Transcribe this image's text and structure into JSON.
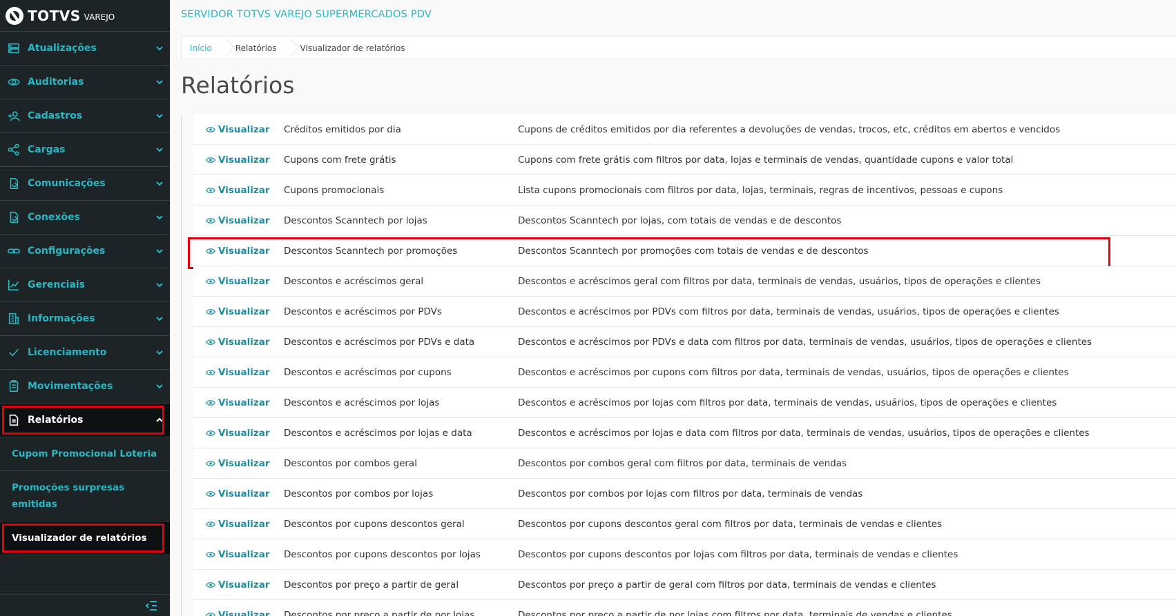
{
  "brand": {
    "name": "TOTVS",
    "sub": "VAREJO"
  },
  "sidebar": {
    "items": [
      {
        "label": "Atualizações",
        "icon": "server-icon"
      },
      {
        "label": "Auditorias",
        "icon": "eye-icon"
      },
      {
        "label": "Cadastros",
        "icon": "user-add-icon"
      },
      {
        "label": "Cargas",
        "icon": "share-icon"
      },
      {
        "label": "Comunicações",
        "icon": "document-sync-icon"
      },
      {
        "label": "Conexões",
        "icon": "document-sync-icon"
      },
      {
        "label": "Configurações",
        "icon": "link-icon"
      },
      {
        "label": "Gerenciais",
        "icon": "chart-icon"
      },
      {
        "label": "Informações",
        "icon": "building-icon"
      },
      {
        "label": "Licenciamento",
        "icon": "check-icon"
      },
      {
        "label": "Movimentações",
        "icon": "clipboard-icon"
      },
      {
        "label": "Relatórios",
        "icon": "report-icon"
      }
    ],
    "subitems": [
      {
        "label": "Cupom Promocional Loteria"
      },
      {
        "label": "Promoções surpresas emitidas"
      },
      {
        "label": "Visualizador de relatórios"
      }
    ]
  },
  "header": {
    "server_title": "SERVIDOR TOTVS VAREJO SUPERMERCADOS PDV"
  },
  "breadcrumb": [
    "Início",
    "Relatórios",
    "Visualizador de relatórios"
  ],
  "page_title": "Relatórios",
  "view_label": "Visualizar",
  "reports": [
    {
      "name": "Créditos emitidos por dia",
      "desc": "Cupons de créditos emitidos por dia referentes a devoluções de vendas, trocos, etc, créditos em abertos e vencidos"
    },
    {
      "name": "Cupons com frete grátis",
      "desc": "Cupons com frete grátis com filtros por data, lojas e terminais de vendas, quantidade cupons e valor total"
    },
    {
      "name": "Cupons promocionais",
      "desc": "Lista cupons promocionais com filtros por data, lojas, terminais, regras de incentivos, pessoas e cupons"
    },
    {
      "name": "Descontos Scanntech por lojas",
      "desc": "Descontos Scanntech por lojas, com totais de vendas e de descontos"
    },
    {
      "name": "Descontos Scanntech por promoções",
      "desc": "Descontos Scanntech por promoções com totais de vendas e de descontos"
    },
    {
      "name": "Descontos e acréscimos geral",
      "desc": "Descontos e acréscimos geral com filtros por data, terminais de vendas, usuários, tipos de operações e clientes"
    },
    {
      "name": "Descontos e acréscimos por PDVs",
      "desc": "Descontos e acréscimos por PDVs com filtros por data, terminais de vendas, usuários, tipos de operações e clientes"
    },
    {
      "name": "Descontos e acréscimos por PDVs e data",
      "desc": "Descontos e acréscimos por PDVs e data com filtros por data, terminais de vendas, usuários, tipos de operações e clientes"
    },
    {
      "name": "Descontos e acréscimos por cupons",
      "desc": "Descontos e acréscimos por cupons com filtros por data, terminais de vendas, usuários, tipos de operações e clientes"
    },
    {
      "name": "Descontos e acréscimos por lojas",
      "desc": "Descontos e acréscimos por lojas com filtros por data, terminais de vendas, usuários, tipos de operações e clientes"
    },
    {
      "name": "Descontos e acréscimos por lojas e data",
      "desc": "Descontos e acréscimos por lojas e data com filtros por data, terminais de vendas, usuários, tipos de operações e clientes"
    },
    {
      "name": "Descontos por combos geral",
      "desc": "Descontos por combos geral com filtros por data, terminais de vendas"
    },
    {
      "name": "Descontos por combos por lojas",
      "desc": "Descontos por combos por lojas com filtros por data, terminais de vendas"
    },
    {
      "name": "Descontos por cupons descontos geral",
      "desc": "Descontos por cupons descontos geral com filtros por data, terminais de vendas e clientes"
    },
    {
      "name": "Descontos por cupons descontos por lojas",
      "desc": "Descontos por cupons descontos por lojas com filtros por data, terminais de vendas e clientes"
    },
    {
      "name": "Descontos por preço a partir de geral",
      "desc": "Descontos por preço a partir de geral com filtros por data, terminais de vendas e clientes"
    },
    {
      "name": "Descontos por preço a partir de por lojas",
      "desc": "Descontos por preço a partir de por lojas com filtros por data, terminais de vendas e clientes"
    }
  ],
  "colors": {
    "sidebar_bg": "#1d2426",
    "accent": "#29b6c5",
    "link": "#1b8fa6",
    "highlight": "#e3000f"
  }
}
